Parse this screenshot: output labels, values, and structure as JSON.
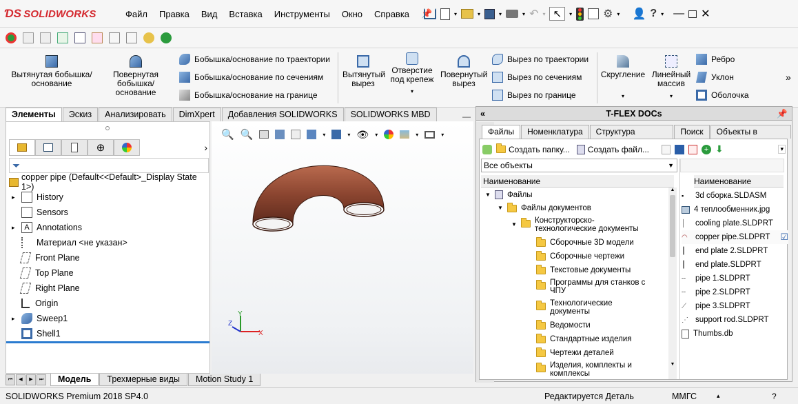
{
  "app": {
    "logo": "SOLIDWORKS"
  },
  "menu": [
    "Файл",
    "Правка",
    "Вид",
    "Вставка",
    "Инструменты",
    "Окно",
    "Справка"
  ],
  "commands": {
    "extrude_boss": "Вытянутая бобышка/основание",
    "revolve_boss": "Повернутая бобышка/основание",
    "sweep_boss": "Бобышка/основание по траектории",
    "loft_boss": "Бобышка/основание по сечениям",
    "boundary_boss": "Бобышка/основание на границе",
    "extrude_cut": "Вытянутый вырез",
    "hole_wizard": "Отверстие под крепеж",
    "revolve_cut": "Повернутый вырез",
    "sweep_cut": "Вырез по траектории",
    "loft_cut": "Вырез по сечениям",
    "boundary_cut": "Вырез по границе",
    "fillet": "Скругление",
    "linear_pattern": "Линейный массив",
    "rib": "Ребро",
    "draft": "Уклон",
    "shell": "Оболочка"
  },
  "tabs": [
    "Элементы",
    "Эскиз",
    "Анализировать",
    "DimXpert",
    "Добавления SOLIDWORKS",
    "SOLIDWORKS MBD"
  ],
  "tree": {
    "root": "copper pipe  (Default<<Default>_Display State 1>)",
    "items": [
      "History",
      "Sensors",
      "Annotations",
      "Материал <не указан>",
      "Front Plane",
      "Top Plane",
      "Right Plane",
      "Origin",
      "Sweep1",
      "Shell1"
    ]
  },
  "axes": {
    "x": "X",
    "y": "Y",
    "z": "Z"
  },
  "bottom_tabs": [
    "Модель",
    "Трехмерные виды",
    "Motion Study 1"
  ],
  "status": {
    "product": "SOLIDWORKS Premium 2018 SP4.0",
    "mode": "Редактируется Деталь",
    "units": "ММГС"
  },
  "tflex": {
    "title": "T-FLEX DOCs",
    "tabs": [
      "Файлы",
      "Номенклатура",
      "Структура изделия",
      "Поиск",
      "Объекты в работе"
    ],
    "create_folder": "Создать папку...",
    "create_file": "Создать файл...",
    "filter": "Все объекты",
    "col_name": "Наименование",
    "tree": [
      {
        "label": "Файлы",
        "level": 0
      },
      {
        "label": "Файлы документов",
        "level": 1
      },
      {
        "label": "Конструкторско-\nтехнологические документы",
        "level": 2
      },
      {
        "label": "Сборочные 3D модели",
        "level": 3
      },
      {
        "label": "Сборочные чертежи",
        "level": 3
      },
      {
        "label": "Текстовые документы",
        "level": 3
      },
      {
        "label": "Программы для станков с\nЧПУ",
        "level": 3
      },
      {
        "label": "Технологические\nдокументы",
        "level": 3
      },
      {
        "label": "Ведомости",
        "level": 3
      },
      {
        "label": "Стандартные изделия",
        "level": 3
      },
      {
        "label": "Чертежи деталей",
        "level": 3
      },
      {
        "label": "Изделия, комплекты и\nкомплексы",
        "level": 3
      }
    ],
    "files": [
      "3d сборка.SLDASM",
      "4 теплообменник.jpg",
      "cooling plate.SLDPRT",
      "copper pipe.SLDPRT",
      "end plate 2.SLDPRT",
      "end plate.SLDPRT",
      "pipe 1.SLDPRT",
      "pipe 2.SLDPRT",
      "pipe 3.SLDPRT",
      "support rod.SLDPRT",
      "Thumbs.db"
    ]
  }
}
